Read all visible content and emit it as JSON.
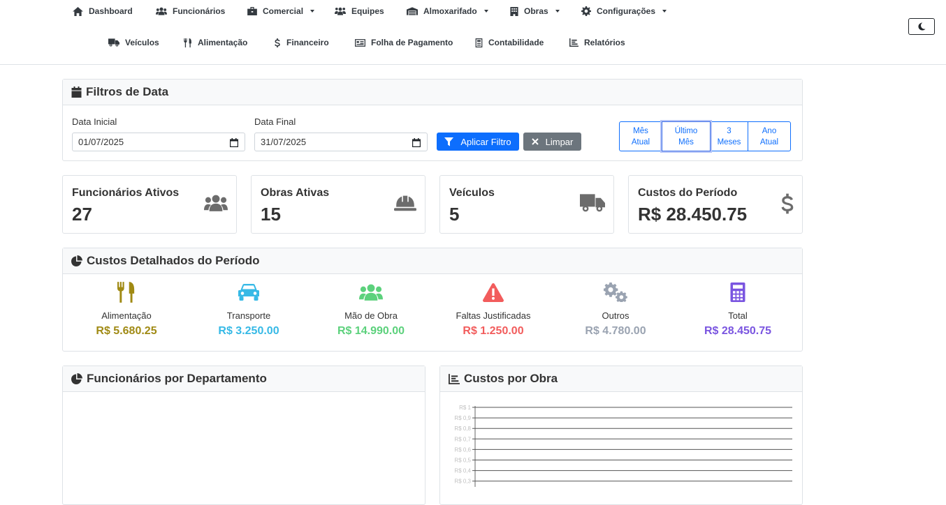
{
  "nav": {
    "row1": [
      {
        "label": "Dashboard",
        "icon": "home-icon",
        "dropdown": false
      },
      {
        "label": "Funcionários",
        "icon": "users-icon",
        "dropdown": false
      },
      {
        "label": "Comercial",
        "icon": "briefcase-icon",
        "dropdown": true
      },
      {
        "label": "Equipes",
        "icon": "team-icon",
        "dropdown": false
      },
      {
        "label": "Almoxarifado",
        "icon": "warehouse-icon",
        "dropdown": true
      },
      {
        "label": "Obras",
        "icon": "building-icon",
        "dropdown": true
      },
      {
        "label": "Configurações",
        "icon": "gear-icon",
        "dropdown": true
      }
    ],
    "row2": [
      {
        "label": "Veículos",
        "icon": "truck-icon"
      },
      {
        "label": "Alimentação",
        "icon": "utensils-icon"
      },
      {
        "label": "Financeiro",
        "icon": "dollar-icon"
      },
      {
        "label": "Folha de Pagamento",
        "icon": "id-card-icon"
      },
      {
        "label": "Contabilidade",
        "icon": "calculator-icon"
      },
      {
        "label": "Relatórios",
        "icon": "chart-icon"
      }
    ]
  },
  "filter": {
    "title": "Filtros de Data",
    "start_label": "Data Inicial",
    "start_value": "01/07/2025",
    "end_label": "Data Final",
    "end_value": "31/07/2025",
    "apply_label": "Aplicar Filtro",
    "clear_label": "Limpar",
    "presets": [
      {
        "line1": "Mês",
        "line2": "Atual",
        "active": false
      },
      {
        "line1": "Último",
        "line2": "Mês",
        "active": true
      },
      {
        "line1": "3",
        "line2": "Meses",
        "active": false
      },
      {
        "line1": "Ano",
        "line2": "Atual",
        "active": false
      }
    ]
  },
  "stats": [
    {
      "title": "Funcionários Ativos",
      "value": "27",
      "icon": "users-icon"
    },
    {
      "title": "Obras Ativas",
      "value": "15",
      "icon": "hard-hat-icon"
    },
    {
      "title": "Veículos",
      "value": "5",
      "icon": "truck-icon"
    },
    {
      "title": "Custos do Período",
      "value": "R$ 28.450.75",
      "icon": "dollar-icon"
    }
  ],
  "costs": {
    "title": "Custos Detalhados do Período",
    "items": [
      {
        "label": "Alimentação",
        "value": "R$ 5.680.25",
        "color": "#a08a14",
        "icon": "utensils-icon"
      },
      {
        "label": "Transporte",
        "value": "R$ 3.250.00",
        "color": "#36b9e6",
        "icon": "car-icon"
      },
      {
        "label": "Mão de Obra",
        "value": "R$ 14.990.00",
        "color": "#5cd17c",
        "icon": "users-icon"
      },
      {
        "label": "Faltas Justificadas",
        "value": "R$ 1.250.00",
        "color": "#f25c5c",
        "icon": "warning-icon"
      },
      {
        "label": "Outros",
        "value": "R$ 4.780.00",
        "color": "#9aa3b1",
        "icon": "gears-icon"
      },
      {
        "label": "Total",
        "value": "R$ 28.450.75",
        "color": "#7a55e0",
        "icon": "calculator-icon"
      }
    ]
  },
  "panels": {
    "dept_title": "Funcionários por Departamento",
    "obra_title": "Custos por Obra"
  },
  "chart_data": {
    "type": "line",
    "title": "Custos por Obra",
    "y_tick_labels": [
      "R$ 1",
      "R$ 0,9",
      "R$ 0,8",
      "R$ 0,7",
      "R$ 0,6",
      "R$ 0,5",
      "R$ 0,4",
      "R$ 0,3"
    ],
    "ylim": [
      0,
      1
    ],
    "grid": true,
    "series": []
  }
}
